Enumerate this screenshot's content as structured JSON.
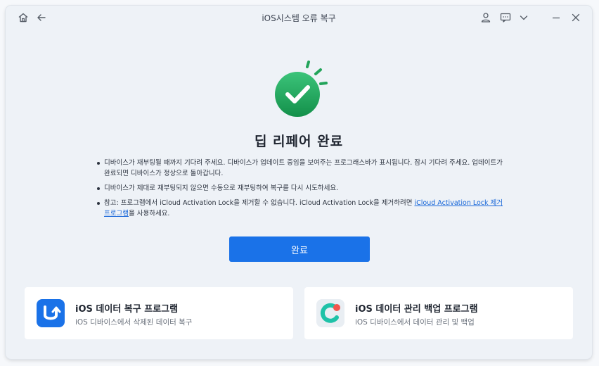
{
  "window": {
    "title": "iOS시스템 오류 복구"
  },
  "icons": {
    "home": "home-icon",
    "back": "back-arrow-icon",
    "user": "user-icon",
    "feedback": "message-icon",
    "menu": "chevron-down-icon",
    "minimize": "minimize-icon",
    "close": "close-icon",
    "success": "check-circle-icon"
  },
  "main": {
    "heading": "딥 리페어 완료",
    "bullets": [
      "디바이스가 재부팅될 때까지 기다려 주세요. 디바이스가 업데이트 중임을 보여주는 프로그래스바가 표시됩니다. 잠시 기다려 주세요. 업데이트가 완료되면 디바이스가 정상으로 돌아갑니다.",
      "디바이스가 제대로 재부팅되지 않으면 수동으로 재부팅하여 복구를 다시 시도하세요."
    ],
    "note": {
      "prefix": "참고: 프로그램에서 iCloud Activation Lock을 제거할 수 없습니다. iCloud Activation Lock을 제거하려면 ",
      "link": "iCloud Activation Lock 제거 프로그램",
      "suffix": "을 사용하세요."
    },
    "done_button": "완료"
  },
  "cards": [
    {
      "title": "iOS 데이터 복구 프로그램",
      "desc": "iOS 디바이스에서 삭제된 데이터 복구"
    },
    {
      "title": "iOS 데이터 관리 백업 프로그램",
      "desc": "iOS 디바이스에서 데이터 관리 및 백업"
    }
  ],
  "colors": {
    "accent": "#1a72e8",
    "success_green": "#22a45a",
    "link": "#1565d8"
  }
}
